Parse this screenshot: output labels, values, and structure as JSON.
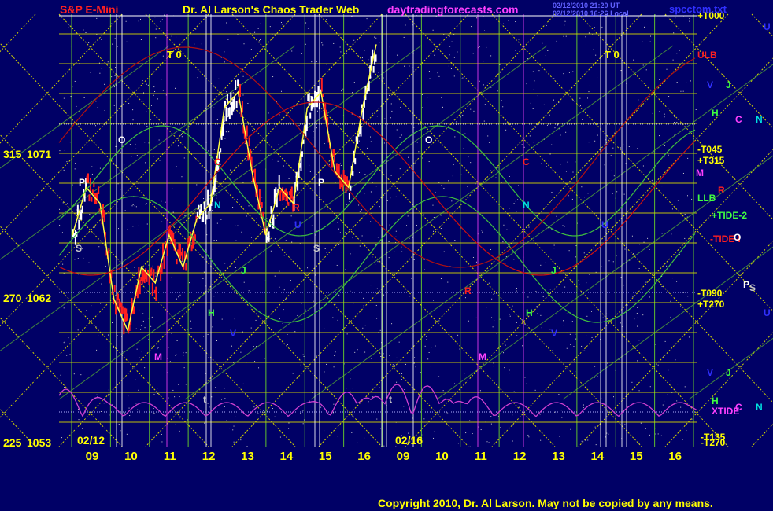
{
  "header": {
    "symbol": "S&P E-Mini",
    "title": "Dr. Al Larson's Chaos Trader Web",
    "site": "daytradingforecasts.com",
    "stamp1": "02/12/2010 21:20 UT",
    "stamp2": "02/12/2010 16:26 Local",
    "file": "spcctom.txt"
  },
  "footer": {
    "copyright": "Copyright 2010, Dr. Al Larson. May not be copied by any means."
  },
  "colors": {
    "background": "#000066",
    "grid_yellow": "#d6d600",
    "grid_green": "#5fbf2f",
    "price_red": "#ff2020",
    "price_white": "#ffffff",
    "tide_magenta": "#d040d0",
    "flux_red": "#cc1010",
    "band_green": "#3fbf3f",
    "session_white": "#ffffff"
  },
  "chart_data": {
    "type": "line",
    "title": "S&P E-Mini",
    "yaxis": {
      "ticks": [
        {
          "angle": "315",
          "price": "1071"
        },
        {
          "angle": "270",
          "price": "1062"
        },
        {
          "angle": "225",
          "price": "1053"
        }
      ],
      "ylim": [
        1053,
        1071
      ]
    },
    "xaxis": {
      "day_labels": [
        "09",
        "10",
        "11",
        "12",
        "13",
        "14",
        "15",
        "16",
        "09",
        "10",
        "11",
        "12",
        "13",
        "14",
        "15",
        "16"
      ],
      "date_labels": [
        "02/12",
        "02/16"
      ]
    },
    "price_path_approx": [
      1066,
      1069,
      1068,
      1062,
      1060,
      1064,
      1063,
      1066,
      1064,
      1067,
      1068,
      1074,
      1075,
      1070,
      1066,
      1069,
      1068,
      1074,
      1075,
      1070,
      1069,
      1074,
      1078
    ],
    "markers_top": [
      "T 0",
      "T 0"
    ],
    "markers_row": [
      {
        "text": "O",
        "color": "#ffffff"
      },
      {
        "text": "P",
        "color": "#ffffff"
      },
      {
        "text": "S",
        "color": "#c8c8c8"
      },
      {
        "text": "M",
        "color": "#ff40ff"
      },
      {
        "text": "t",
        "color": "#c8c8c8"
      },
      {
        "text": "C",
        "color": "#ff2020"
      },
      {
        "text": "N",
        "color": "#00e0e0"
      },
      {
        "text": "J",
        "color": "#40ff40"
      },
      {
        "text": "H",
        "color": "#40ff40"
      },
      {
        "text": "U",
        "color": "#3030ff"
      },
      {
        "text": "R",
        "color": "#ff2020"
      },
      {
        "text": "V",
        "color": "#3030ff"
      }
    ],
    "right_labels": [
      {
        "text": "+T000",
        "color": "#ffff00"
      },
      {
        "text": "ULB",
        "color": "#ff2020"
      },
      {
        "text": "-T045",
        "color": "#ffff00"
      },
      {
        "text": "+T315",
        "color": "#ffff00"
      },
      {
        "text": "M",
        "color": "#ff40ff"
      },
      {
        "text": "LLB",
        "color": "#40ff40"
      },
      {
        "text": "+TIDE-2",
        "color": "#40ff40"
      },
      {
        "text": "-TIDE-I",
        "color": "#ff2020"
      },
      {
        "text": "-T090",
        "color": "#ffff00"
      },
      {
        "text": "+T270",
        "color": "#ffff00"
      },
      {
        "text": "XTIDE",
        "color": "#ff40ff"
      },
      {
        "text": "-T135",
        "color": "#ffff00"
      },
      {
        "text": "-T270",
        "color": "#ffff00"
      }
    ],
    "far_right_letters": [
      {
        "text": "U",
        "color": "#3030ff"
      },
      {
        "text": "V",
        "color": "#3030ff"
      },
      {
        "text": "J",
        "color": "#40ff40"
      },
      {
        "text": "H",
        "color": "#40ff40"
      },
      {
        "text": "C",
        "color": "#ff40ff"
      },
      {
        "text": "N",
        "color": "#00e0e0"
      },
      {
        "text": "R",
        "color": "#ff2020"
      },
      {
        "text": "O",
        "color": "#ffffff"
      },
      {
        "text": "P",
        "color": "#ffffff"
      },
      {
        "text": "S",
        "color": "#c8c8c8"
      },
      {
        "text": "U",
        "color": "#3030ff"
      },
      {
        "text": "V",
        "color": "#3030ff"
      },
      {
        "text": "J",
        "color": "#40ff40"
      },
      {
        "text": "H",
        "color": "#40ff40"
      },
      {
        "text": "C",
        "color": "#ff40ff"
      },
      {
        "text": "N",
        "color": "#00e0e0"
      }
    ]
  }
}
